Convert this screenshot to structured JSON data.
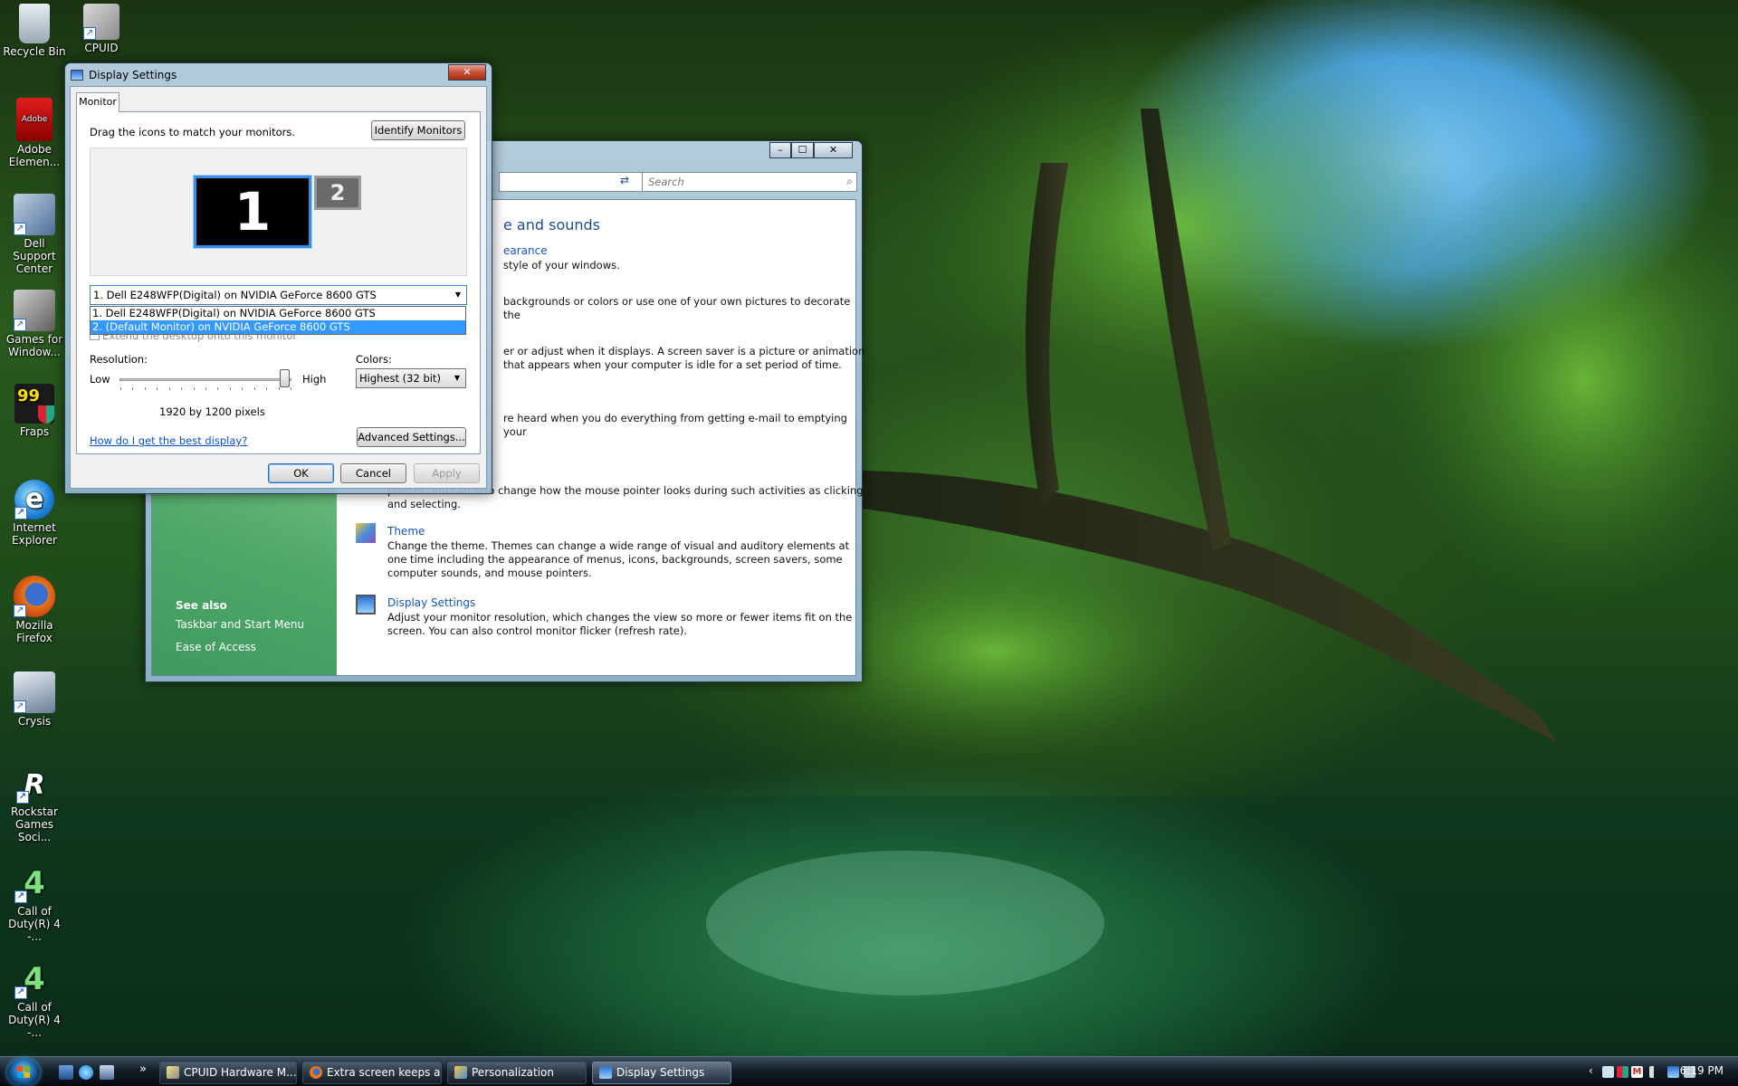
{
  "desktop": {
    "icons": [
      {
        "label": "Recycle Bin"
      },
      {
        "label": "CPUID"
      },
      {
        "label": "Adobe Elemen..."
      },
      {
        "label": "Dell Support Center"
      },
      {
        "label": "Games for Window..."
      },
      {
        "label": "Fraps"
      },
      {
        "label": "Internet Explorer"
      },
      {
        "label": "Mozilla Firefox"
      },
      {
        "label": "Crysis"
      },
      {
        "label": "Rockstar Games Soci..."
      },
      {
        "label": "Call of Duty(R) 4 -..."
      },
      {
        "label": "Call of Duty(R) 4 -..."
      }
    ],
    "adobe_badge": "Adobe",
    "fraps_badge": "99",
    "cod_badge": "4"
  },
  "personalization": {
    "search_placeholder": "Search",
    "heading": "e and sounds",
    "tasks": [
      {
        "link": "earance",
        "desc": "style of your windows."
      },
      {
        "link": "",
        "desc": "backgrounds or colors or use one of your own pictures to decorate the"
      },
      {
        "link": "",
        "desc": "er or adjust when it displays. A screen saver is a picture or animation that appears when your computer is idle for a set period of time."
      },
      {
        "link": "",
        "desc": "re heard when you do everything from getting e-mail to emptying your"
      },
      {
        "link": "",
        "desc": "pointer. You can also change how the mouse pointer looks during such activities as clicking and selecting."
      },
      {
        "link": "Theme",
        "desc": "Change the theme. Themes can change a wide range of visual and auditory elements at one time including the appearance of menus, icons, backgrounds, screen savers, some computer sounds, and mouse pointers."
      },
      {
        "link": "Display Settings",
        "desc": "Adjust your monitor resolution, which changes the view so more or fewer items fit on the screen. You can also control monitor flicker (refresh rate)."
      }
    ],
    "see_also": {
      "title": "See also",
      "items": [
        "Taskbar and Start Menu",
        "Ease of Access"
      ]
    }
  },
  "display_settings": {
    "title": "Display Settings",
    "tab": "Monitor",
    "instruction": "Drag the icons to match your monitors.",
    "identify_button": "Identify Monitors",
    "monitor_1": "1",
    "monitor_2": "2",
    "monitor_select": {
      "value": "1. Dell E248WFP(Digital) on NVIDIA GeForce 8600 GTS",
      "options": [
        "1. Dell E248WFP(Digital) on NVIDIA GeForce 8600 GTS",
        "2. (Default Monitor) on NVIDIA GeForce 8600 GTS"
      ],
      "highlighted_index": 1
    },
    "extend_checkbox": "Extend the desktop onto this monitor",
    "resolution_label": "Resolution:",
    "low_label": "Low",
    "high_label": "High",
    "resolution_value": "1920 by 1200 pixels",
    "resolution_slider_fraction": 1.0,
    "colors_label": "Colors:",
    "colors_value": "Highest (32 bit)",
    "help_link": "How do I get the best display?",
    "advanced_button": "Advanced Settings...",
    "ok_button": "OK",
    "cancel_button": "Cancel",
    "apply_button": "Apply"
  },
  "taskbar": {
    "items": [
      {
        "label": "CPUID Hardware M..."
      },
      {
        "label": "Extra screen keeps a..."
      },
      {
        "label": "Personalization"
      },
      {
        "label": "Display Settings"
      }
    ],
    "overflow": "»",
    "clock": "6:19 PM"
  },
  "colors": {
    "accent": "#3399ff",
    "link": "#1457b8",
    "sidebar_green": "#4fa86a"
  }
}
